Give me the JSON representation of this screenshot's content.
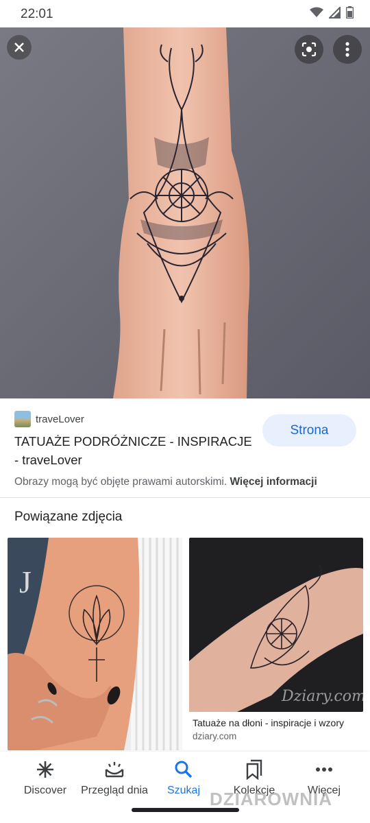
{
  "status": {
    "time": "22:01"
  },
  "result": {
    "source_name": "traveLover",
    "title": "TATUAŻE PODRÓŻNICZE - INSPIRACJE - traveLover",
    "visit_button": "Strona",
    "copyright_text": "Obrazy mogą być objęte prawami autorskimi.",
    "more_info_link": "Więcej informacji"
  },
  "related": {
    "heading": "Powiązane zdjęcia",
    "items": [
      {
        "title": "",
        "source": ""
      },
      {
        "title": "Tatuaże na dłoni - inspiracje i wzory",
        "source": "dziary.com"
      }
    ]
  },
  "bottom_nav": {
    "items": [
      {
        "label": "Discover",
        "icon": "asterisk-icon"
      },
      {
        "label": "Przegląd dnia",
        "icon": "sunrise-icon"
      },
      {
        "label": "Szukaj",
        "icon": "search-icon",
        "active": true
      },
      {
        "label": "Kolekcje",
        "icon": "collections-icon"
      },
      {
        "label": "Więcej",
        "icon": "more-horiz-icon"
      }
    ]
  },
  "watermark": "DZIAROWNIA",
  "colors": {
    "accent": "#1a73e8",
    "button_bg": "#e8f0fe",
    "button_text": "#1967d2"
  }
}
